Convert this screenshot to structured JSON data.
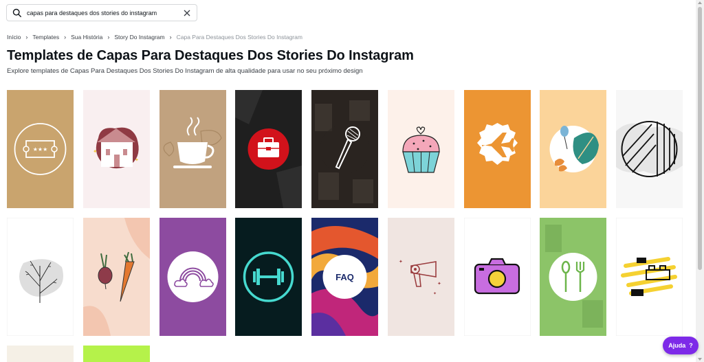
{
  "search": {
    "value": "capas para destaques dos stories do instagram",
    "placeholder": "",
    "icon": "search-icon",
    "clear_icon": "close-icon"
  },
  "breadcrumb": {
    "items": [
      "Início",
      "Templates",
      "Sua História",
      "Story Do Instagram"
    ],
    "current": "Capa Para Destaques Dos Stories Do Instagram",
    "separator": "›"
  },
  "page": {
    "title": "Templates de Capas Para Destaques Dos Stories Do Instagram",
    "subtitle": "Explore templates de Capas Para Destaques Dos Stories Do Instagram de alta qualidade para usar no seu próximo design"
  },
  "templates": [
    {
      "name": "ticket",
      "icon": "ticket-icon",
      "bg": "#c9a46e"
    },
    {
      "name": "house",
      "icon": "house-icon",
      "bg": "#f9eff0"
    },
    {
      "name": "coffee",
      "icon": "coffee-cup-icon",
      "bg": "#c1a27f"
    },
    {
      "name": "toolbox",
      "icon": "toolbox-icon",
      "bg": "#1f1f1f"
    },
    {
      "name": "microphone",
      "icon": "microphone-icon",
      "bg": "#2a2420"
    },
    {
      "name": "cupcake",
      "icon": "cupcake-icon",
      "bg": "#fdf1ea"
    },
    {
      "name": "airplane",
      "icon": "airplane-icon",
      "bg": "#ec9533"
    },
    {
      "name": "leaf",
      "icon": "leaf-icon",
      "bg": "#fbd49a"
    },
    {
      "name": "circle-lines",
      "icon": "circle-lines-icon",
      "bg": "#f7f7f7"
    },
    {
      "name": "plant",
      "icon": "plant-icon",
      "bg": "#ffffff"
    },
    {
      "name": "vegetables",
      "icon": "carrot-icon",
      "bg": "#f7dccd"
    },
    {
      "name": "rainbow",
      "icon": "rainbow-icon",
      "bg": "#8d4ba0"
    },
    {
      "name": "dumbbell",
      "icon": "dumbbell-icon",
      "bg": "#061c1f"
    },
    {
      "name": "faq",
      "icon": "faq-icon",
      "bg": "#1b2a6b",
      "label": "FAQ"
    },
    {
      "name": "hairdryer",
      "icon": "hairdryer-icon",
      "bg": "#f0e5e1"
    },
    {
      "name": "camera",
      "icon": "camera-icon",
      "bg": "#ffffff"
    },
    {
      "name": "cutlery",
      "icon": "cutlery-icon",
      "bg": "#8cc468"
    },
    {
      "name": "bricks",
      "icon": "bricks-icon",
      "bg": "#ffffff"
    },
    {
      "name": "partial-1",
      "icon": "",
      "bg": "#f5f0e6"
    },
    {
      "name": "partial-2",
      "icon": "",
      "bg": "#b5f24a"
    }
  ],
  "help": {
    "label": "Ajuda",
    "icon": "question-mark-icon",
    "color": "#7d2ae8"
  }
}
